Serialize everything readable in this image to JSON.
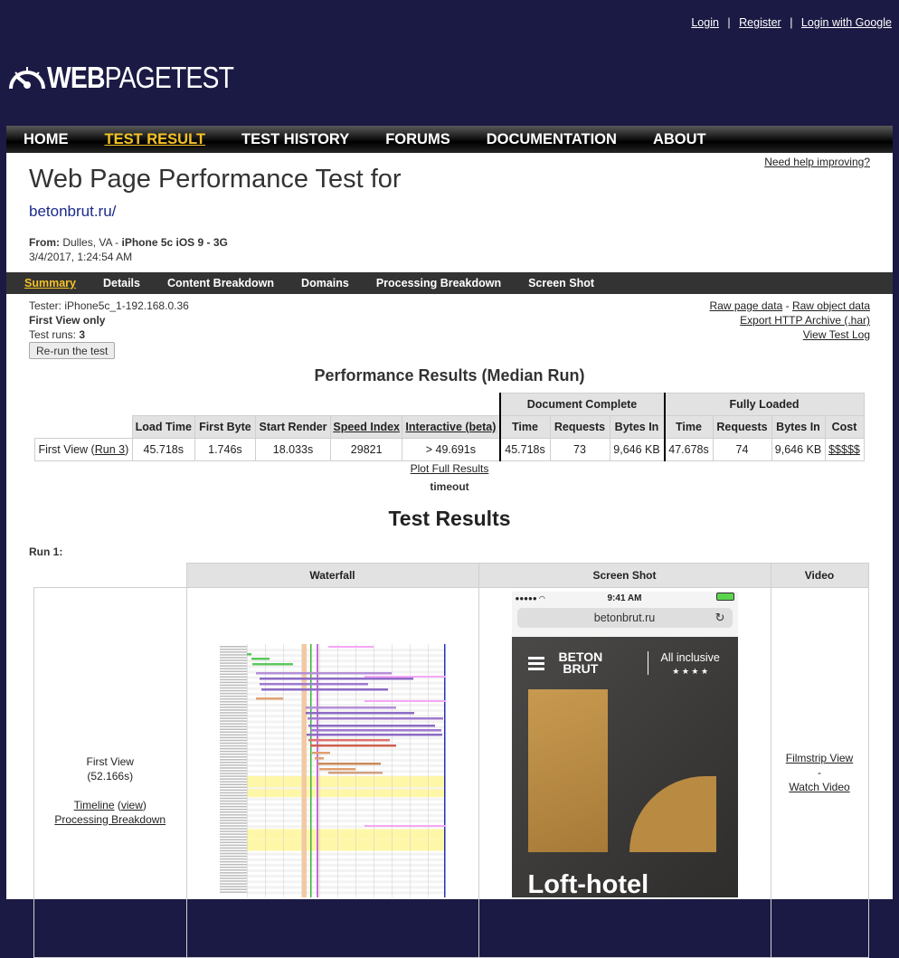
{
  "auth": {
    "login": "Login",
    "sep": "|",
    "register": "Register",
    "login_google": "Login with Google"
  },
  "logo": {
    "bold": "WEB",
    "rest": "PAGETEST"
  },
  "nav": {
    "home": "HOME",
    "test_result": "TEST RESULT",
    "test_history": "TEST HISTORY",
    "forums": "FORUMS",
    "documentation": "DOCUMENTATION",
    "about": "ABOUT"
  },
  "page": {
    "help_link": "Need help improving?",
    "title": "Web Page Performance Test for",
    "url": "betonbrut.ru/",
    "from_label": "From:",
    "from_location": "Dulles, VA",
    "from_device": "iPhone 5c iOS 9 - 3G",
    "date": "3/4/2017, 1:24:54 AM"
  },
  "subnav": {
    "summary": "Summary",
    "details": "Details",
    "content_breakdown": "Content Breakdown",
    "domains": "Domains",
    "processing_breakdown": "Processing Breakdown",
    "screen_shot": "Screen Shot"
  },
  "tester": {
    "tester_line": "Tester: iPhone5c_1-192.168.0.36",
    "first_view_only": "First View only",
    "test_runs_label": "Test runs:",
    "test_runs_value": "3",
    "rerun_button": "Re-run the test"
  },
  "raw": {
    "page_data": "Raw page data",
    "dash": "-",
    "object_data": "Raw object data",
    "har": "Export HTTP Archive (.har)",
    "test_log": "View Test Log"
  },
  "perf": {
    "title": "Performance Results (Median Run)",
    "groups": {
      "doc_complete": "Document Complete",
      "fully_loaded": "Fully Loaded"
    },
    "headers": [
      "Load Time",
      "First Byte",
      "Start Render",
      "Speed Index",
      "Interactive (beta)",
      "Time",
      "Requests",
      "Bytes In",
      "Time",
      "Requests",
      "Bytes In",
      "Cost"
    ],
    "row": {
      "label": "First View (",
      "run_link": "Run 3",
      "label_end": ")",
      "values": [
        "45.718s",
        "1.746s",
        "18.033s",
        "29821",
        "> 49.691s",
        "45.718s",
        "73",
        "9,646 KB",
        "47.678s",
        "74",
        "9,646 KB",
        "$$$$$"
      ]
    },
    "plot_link": "Plot Full Results",
    "timeout": "timeout"
  },
  "test_results": {
    "title": "Test Results",
    "run_label": "Run 1:",
    "headers": {
      "waterfall": "Waterfall",
      "screenshot": "Screen Shot",
      "video": "Video"
    },
    "first_view": "First View",
    "first_view_time": "(52.166s)",
    "timeline": "Timeline",
    "view": "view",
    "processing_breakdown": "Processing Breakdown",
    "filmstrip": "Filmstrip View",
    "dash": "-",
    "watch_video": "Watch Video"
  },
  "screenshot": {
    "time": "9:41 AM",
    "url": "betonbrut.ru",
    "brand_top": "BETON",
    "brand_bottom": "BRUT",
    "tagline": "All inclusive",
    "stars": "★ ★ ★ ★",
    "headline": "Loft-hotel"
  }
}
